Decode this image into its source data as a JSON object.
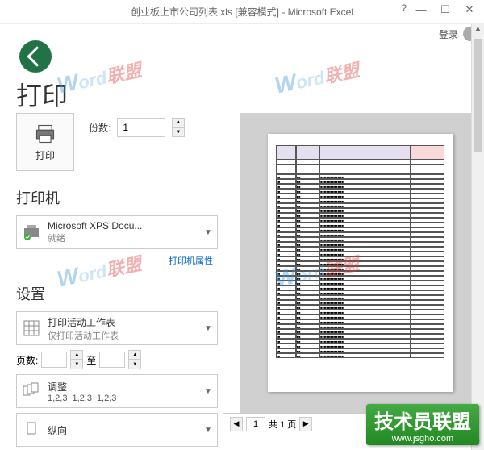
{
  "titlebar": {
    "filename": "创业板上市公司列表.xls",
    "mode": "[兼容模式]",
    "app": "Microsoft Excel"
  },
  "userbar": {
    "login": "登录"
  },
  "page": {
    "title": "打印"
  },
  "print_button": {
    "label": "打印"
  },
  "copies": {
    "label": "份数:",
    "value": "1"
  },
  "printer": {
    "header": "打印机",
    "name": "Microsoft XPS Docu...",
    "status": "就绪",
    "props_link": "打印机属性"
  },
  "settings": {
    "header": "设置",
    "active_sheets": {
      "title": "打印活动工作表",
      "sub": "仅打印活动工作表"
    },
    "pages": {
      "label_from": "页数:",
      "label_to": "至"
    },
    "collate": {
      "title": "调整",
      "seq": "1,2,3"
    },
    "orientation": {
      "title": "纵向"
    }
  },
  "preview": {
    "current_page": "1",
    "total": "1"
  },
  "banner": {
    "text": "技术员联盟",
    "url": "www.jsgho.com"
  }
}
